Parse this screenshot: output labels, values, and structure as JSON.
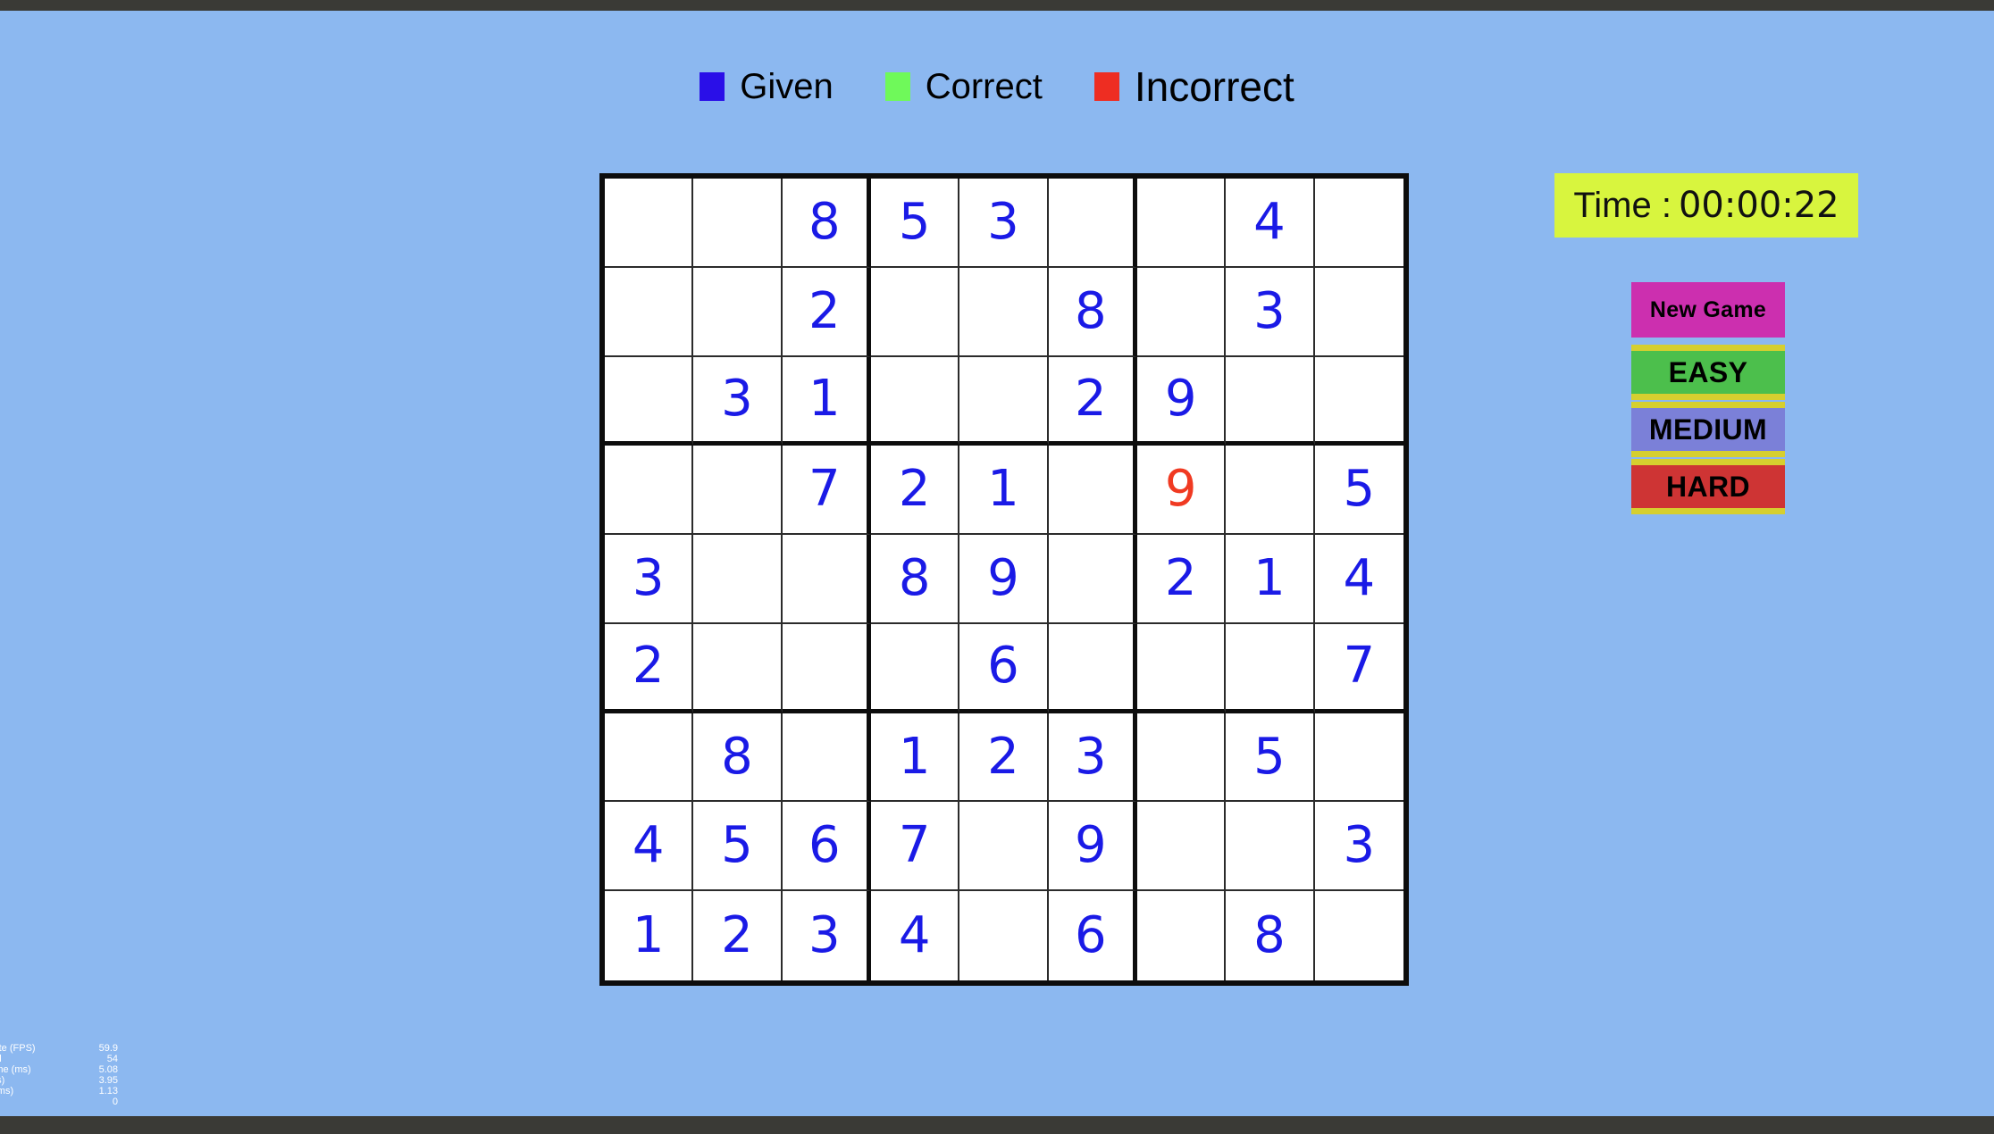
{
  "legend": {
    "items": [
      {
        "label": "Given",
        "color": "#2a0fe8",
        "icon": "square-swatch-icon"
      },
      {
        "label": "Correct",
        "color": "#6ff95a",
        "icon": "square-swatch-icon"
      },
      {
        "label": "Incorrect",
        "color": "#ee2d22",
        "icon": "square-swatch-icon"
      }
    ]
  },
  "board": {
    "rows": [
      [
        {
          "v": "",
          "s": "empty"
        },
        {
          "v": "",
          "s": "empty"
        },
        {
          "v": "8",
          "s": "given"
        },
        {
          "v": "5",
          "s": "given"
        },
        {
          "v": "3",
          "s": "given"
        },
        {
          "v": "",
          "s": "empty"
        },
        {
          "v": "",
          "s": "empty"
        },
        {
          "v": "4",
          "s": "given"
        },
        {
          "v": "",
          "s": "empty"
        }
      ],
      [
        {
          "v": "",
          "s": "empty"
        },
        {
          "v": "",
          "s": "empty"
        },
        {
          "v": "2",
          "s": "given"
        },
        {
          "v": "",
          "s": "empty"
        },
        {
          "v": "",
          "s": "empty"
        },
        {
          "v": "8",
          "s": "given"
        },
        {
          "v": "",
          "s": "empty"
        },
        {
          "v": "3",
          "s": "given"
        },
        {
          "v": "",
          "s": "empty"
        }
      ],
      [
        {
          "v": "",
          "s": "empty"
        },
        {
          "v": "3",
          "s": "given"
        },
        {
          "v": "1",
          "s": "given"
        },
        {
          "v": "",
          "s": "empty"
        },
        {
          "v": "",
          "s": "empty"
        },
        {
          "v": "2",
          "s": "given"
        },
        {
          "v": "9",
          "s": "given"
        },
        {
          "v": "",
          "s": "empty"
        },
        {
          "v": "",
          "s": "empty"
        }
      ],
      [
        {
          "v": "",
          "s": "empty"
        },
        {
          "v": "",
          "s": "empty"
        },
        {
          "v": "7",
          "s": "given"
        },
        {
          "v": "2",
          "s": "given"
        },
        {
          "v": "1",
          "s": "given"
        },
        {
          "v": "",
          "s": "empty"
        },
        {
          "v": "9",
          "s": "incorrect"
        },
        {
          "v": "",
          "s": "empty"
        },
        {
          "v": "5",
          "s": "given"
        }
      ],
      [
        {
          "v": "3",
          "s": "given"
        },
        {
          "v": "",
          "s": "empty"
        },
        {
          "v": "",
          "s": "empty"
        },
        {
          "v": "8",
          "s": "given"
        },
        {
          "v": "9",
          "s": "given"
        },
        {
          "v": "",
          "s": "empty"
        },
        {
          "v": "2",
          "s": "given"
        },
        {
          "v": "1",
          "s": "given"
        },
        {
          "v": "4",
          "s": "given"
        }
      ],
      [
        {
          "v": "2",
          "s": "given"
        },
        {
          "v": "",
          "s": "empty"
        },
        {
          "v": "",
          "s": "empty"
        },
        {
          "v": "",
          "s": "empty"
        },
        {
          "v": "6",
          "s": "given"
        },
        {
          "v": "",
          "s": "empty"
        },
        {
          "v": "",
          "s": "empty"
        },
        {
          "v": "",
          "s": "empty"
        },
        {
          "v": "7",
          "s": "given"
        }
      ],
      [
        {
          "v": "",
          "s": "empty"
        },
        {
          "v": "8",
          "s": "given"
        },
        {
          "v": "",
          "s": "empty"
        },
        {
          "v": "1",
          "s": "given"
        },
        {
          "v": "2",
          "s": "given"
        },
        {
          "v": "3",
          "s": "given"
        },
        {
          "v": "",
          "s": "empty"
        },
        {
          "v": "5",
          "s": "given"
        },
        {
          "v": "",
          "s": "empty"
        }
      ],
      [
        {
          "v": "4",
          "s": "given"
        },
        {
          "v": "5",
          "s": "given"
        },
        {
          "v": "6",
          "s": "given"
        },
        {
          "v": "7",
          "s": "given"
        },
        {
          "v": "",
          "s": "empty"
        },
        {
          "v": "9",
          "s": "given"
        },
        {
          "v": "",
          "s": "empty"
        },
        {
          "v": "",
          "s": "empty"
        },
        {
          "v": "3",
          "s": "given"
        }
      ],
      [
        {
          "v": "1",
          "s": "given"
        },
        {
          "v": "2",
          "s": "given"
        },
        {
          "v": "3",
          "s": "given"
        },
        {
          "v": "4",
          "s": "given"
        },
        {
          "v": "",
          "s": "empty"
        },
        {
          "v": "6",
          "s": "given"
        },
        {
          "v": "",
          "s": "empty"
        },
        {
          "v": "8",
          "s": "given"
        },
        {
          "v": "",
          "s": "empty"
        }
      ]
    ]
  },
  "panel": {
    "timer": {
      "label": "Time :",
      "value": "00:00:22",
      "background": "#d8f53e"
    },
    "buttons": [
      {
        "label": "New Game",
        "color": "#cc2faf",
        "name": "new-game-button"
      },
      {
        "label": "EASY",
        "color": "#4cbf4c",
        "name": "difficulty-easy-button"
      },
      {
        "label": "MEDIUM",
        "color": "#7b80d8",
        "name": "difficulty-medium-button"
      },
      {
        "label": "HARD",
        "color": "#ce3434",
        "name": "difficulty-hard-button"
      }
    ]
  },
  "stats": {
    "rows": [
      {
        "label": "Frame rate (FPS)",
        "value": "59.9"
      },
      {
        "label": "Draw Call",
        "value": "54"
      },
      {
        "label": "Frame time (ms)",
        "value": "5.08"
      },
      {
        "label": "Logic (ms)",
        "value": "3.95"
      },
      {
        "label": "Render (ms)",
        "value": "1.13"
      },
      {
        "label": "",
        "value": "0"
      }
    ]
  },
  "theme": {
    "background": "#8cb8f0",
    "given_color": "#1a1ae6",
    "incorrect_color": "#f03a22",
    "grid_line": "#0d0d0d"
  }
}
